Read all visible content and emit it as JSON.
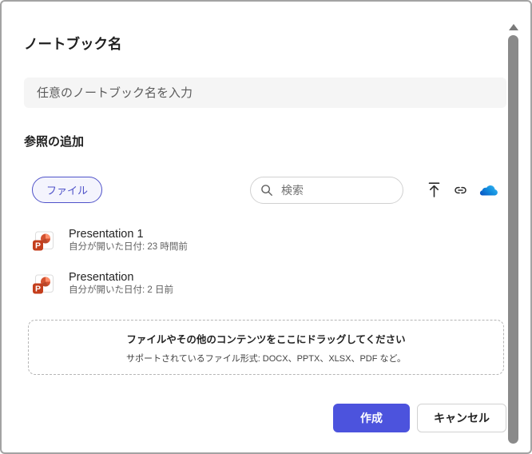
{
  "dialog": {
    "title": "ノートブック名"
  },
  "notebook_name_input": {
    "value": "",
    "placeholder": "任意のノートブック名を入力"
  },
  "references": {
    "heading": "参照の追加",
    "file_filter_label": "ファイル",
    "search_placeholder": "検索"
  },
  "files": [
    {
      "name": "Presentation 1",
      "opened": "自分が開いた日付: 23 時間前",
      "type": "powerpoint"
    },
    {
      "name": "Presentation",
      "opened": "自分が開いた日付: 2 日前",
      "type": "powerpoint"
    }
  ],
  "dropzone": {
    "title": "ファイルやその他のコンテンツをここにドラッグしてください",
    "subtitle": "サポートされているファイル形式: DOCX、PPTX、XLSX、PDF など。"
  },
  "actions": {
    "create": "作成",
    "cancel": "キャンセル"
  },
  "icons": {
    "search": "search-icon",
    "upload": "upload-icon",
    "link": "link-icon",
    "onedrive": "onedrive-cloud-icon",
    "powerpoint": "powerpoint-file-icon",
    "scrollbar_up": "scroll-up-arrow-icon"
  },
  "colors": {
    "accent": "#4c53dd",
    "pill_accent": "#4f52c9",
    "onedrive_blue": "#1490df",
    "powerpoint_red": "#c43e1c"
  }
}
